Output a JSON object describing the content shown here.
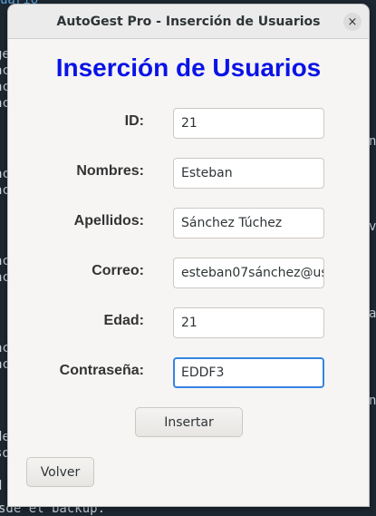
{
  "window": {
    "title": "AutoGest Pro - Inserción de Usuarios",
    "close_glyph": "×"
  },
  "heading": "Inserción de Usuarios",
  "form": {
    "id": {
      "label": "ID:",
      "value": "21"
    },
    "nombres": {
      "label": "Nombres:",
      "value": "Esteban"
    },
    "apellidos": {
      "label": "Apellidos:",
      "value": "Sánchez Túchez"
    },
    "correo": {
      "label": "Correo:",
      "value": "esteban07sánchez@us"
    },
    "edad": {
      "label": "Edad:",
      "value": "21"
    },
    "contrasena": {
      "label": "Contraseña:",
      "value": "EDDF3"
    }
  },
  "buttons": {
    "insertar": "Insertar",
    "volver": "Volver"
  },
  "background_terminal": {
    "left_fragments": [
      "ge",
      "ac",
      "ac",
      "ac",
      "ac",
      "ac",
      "ac",
      "ac",
      "ac",
      "ac",
      "de",
      "so",
      "d"
    ],
    "right_fragments": [
      "n",
      "v",
      "a",
      "n"
    ],
    "bottom_text": "sde el backup.",
    "top_text": "uario"
  },
  "colors": {
    "heading": "#0a13e6",
    "focus_border": "#3584e4",
    "window_bg": "#f6f5f4",
    "terminal_bg": "#1d2731"
  }
}
